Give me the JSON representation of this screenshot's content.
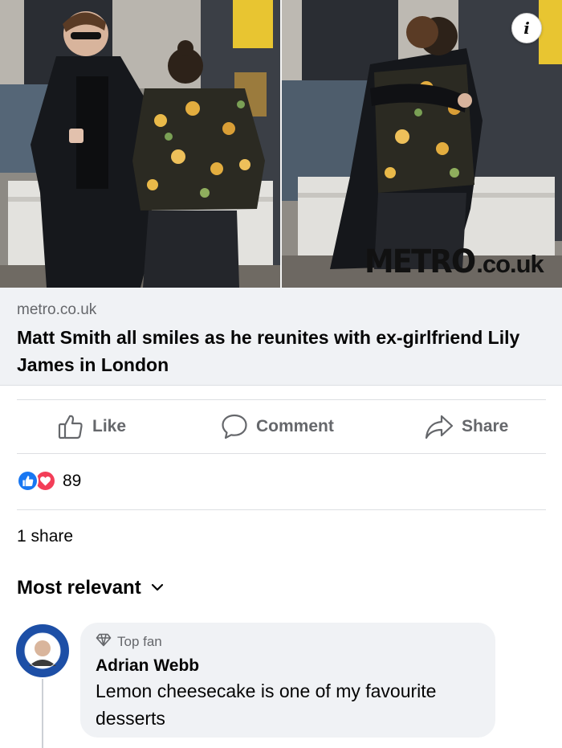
{
  "preview": {
    "watermark_brand": "METRO",
    "watermark_tld": ".co.uk",
    "info_glyph": "i"
  },
  "link": {
    "domain": "metro.co.uk",
    "title": "Matt Smith all smiles as he reunites with ex-girlfriend Lily James in London"
  },
  "actions": {
    "like_label": "Like",
    "comment_label": "Comment",
    "share_label": "Share",
    "like_icon": "thumbs-up-icon",
    "comment_icon": "speech-bubble-icon",
    "share_icon": "share-arrow-icon"
  },
  "stats": {
    "reaction_count": "89",
    "reaction_types": [
      "like",
      "love"
    ],
    "shares": "1 share"
  },
  "comments": {
    "sort_label": "Most relevant",
    "items": [
      {
        "badge": "Top fan",
        "author": "Adrian Webb",
        "text": "Lemon cheesecake is one of my favourite desserts"
      }
    ]
  },
  "colors": {
    "facebook_blue": "#1877f2",
    "love_red": "#f33e58",
    "secondary_text": "#65676b",
    "meta_background": "#f0f2f5"
  }
}
